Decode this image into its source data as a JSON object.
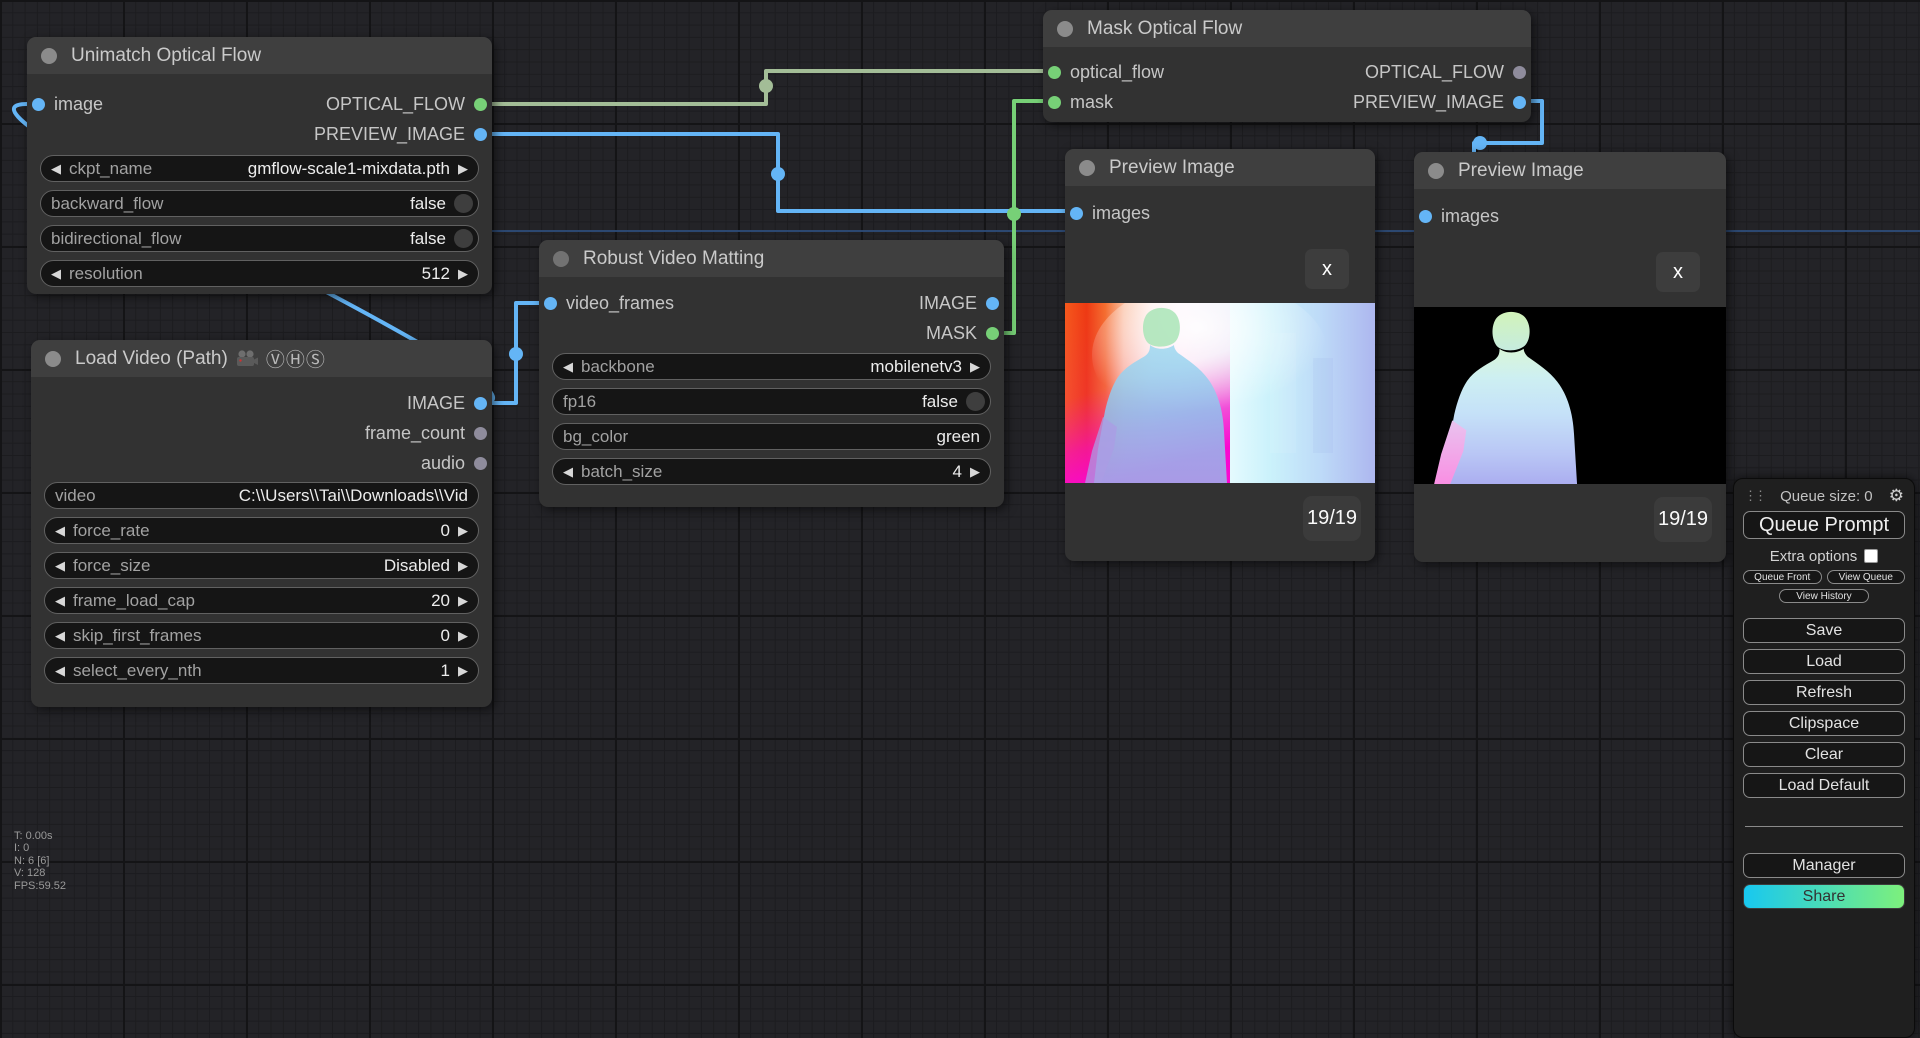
{
  "canvas": {
    "stats": [
      "T: 0.00s",
      "I: 0",
      "N: 6 [6]",
      "V: 128",
      "FPS:59.52"
    ]
  },
  "nodes": {
    "unimatch": {
      "title": "Unimatch Optical Flow",
      "inputs": [
        {
          "name": "image"
        }
      ],
      "outputs": [
        {
          "name": "OPTICAL_FLOW"
        },
        {
          "name": "PREVIEW_IMAGE"
        }
      ],
      "widgets": [
        {
          "label": "ckpt_name",
          "value": "gmflow-scale1-mixdata.pth"
        },
        {
          "label": "backward_flow",
          "value": "false"
        },
        {
          "label": "bidirectional_flow",
          "value": "false"
        },
        {
          "label": "resolution",
          "value": "512"
        }
      ]
    },
    "load_video": {
      "title": "Load Video (Path)",
      "badges": "ⓋⒽⓈ",
      "outputs": [
        {
          "name": "IMAGE"
        },
        {
          "name": "frame_count"
        },
        {
          "name": "audio"
        }
      ],
      "widgets": [
        {
          "label": "video",
          "value": "C:\\\\Users\\\\Tai\\\\Downloads\\\\Vid"
        },
        {
          "label": "force_rate",
          "value": "0"
        },
        {
          "label": "force_size",
          "value": "Disabled"
        },
        {
          "label": "frame_load_cap",
          "value": "20"
        },
        {
          "label": "skip_first_frames",
          "value": "0"
        },
        {
          "label": "select_every_nth",
          "value": "1"
        }
      ]
    },
    "rvm": {
      "title": "Robust Video Matting",
      "inputs": [
        {
          "name": "video_frames"
        }
      ],
      "outputs": [
        {
          "name": "IMAGE"
        },
        {
          "name": "MASK"
        }
      ],
      "widgets": [
        {
          "label": "backbone",
          "value": "mobilenetv3"
        },
        {
          "label": "fp16",
          "value": "false"
        },
        {
          "label": "bg_color",
          "value": "green"
        },
        {
          "label": "batch_size",
          "value": "4"
        }
      ]
    },
    "mask_of": {
      "title": "Mask Optical Flow",
      "inputs": [
        {
          "name": "optical_flow"
        },
        {
          "name": "mask"
        }
      ],
      "outputs": [
        {
          "name": "OPTICAL_FLOW"
        },
        {
          "name": "PREVIEW_IMAGE"
        }
      ]
    },
    "preview1": {
      "title": "Preview Image",
      "inputs": [
        {
          "name": "images"
        }
      ],
      "close": "x",
      "badge": "19/19"
    },
    "preview2": {
      "title": "Preview Image",
      "inputs": [
        {
          "name": "images"
        }
      ],
      "close": "x",
      "badge": "19/19"
    }
  },
  "menu": {
    "queue_size": "Queue size: 0",
    "queue_prompt": "Queue Prompt",
    "extra_options": "Extra options",
    "queue_front": "Queue Front",
    "view_queue": "View Queue",
    "view_history": "View History",
    "save": "Save",
    "load": "Load",
    "refresh": "Refresh",
    "clipspace": "Clipspace",
    "clear": "Clear",
    "load_default": "Load Default",
    "manager": "Manager",
    "share": "Share"
  }
}
